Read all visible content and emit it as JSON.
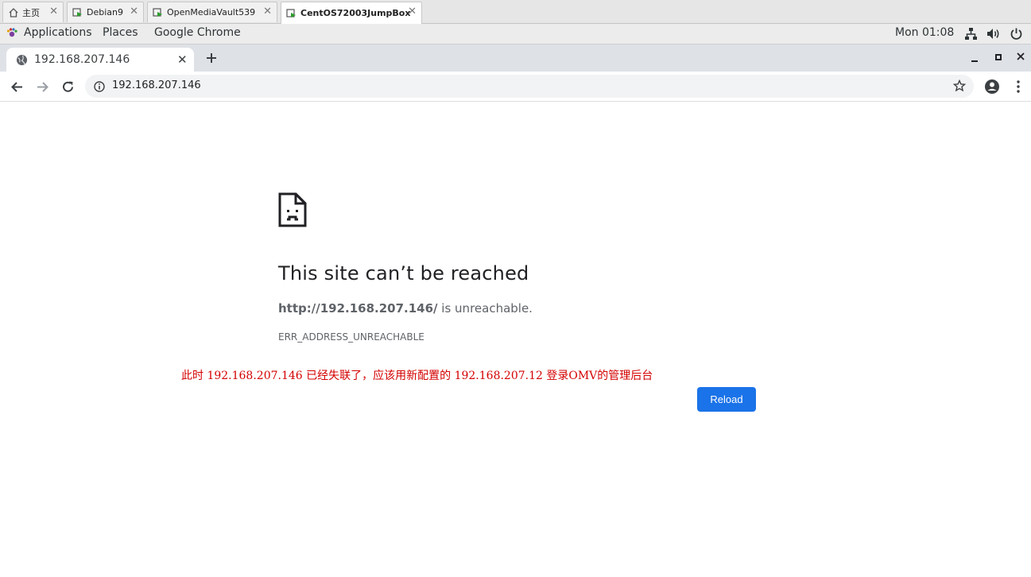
{
  "vm_tabs": [
    {
      "label": "主页"
    },
    {
      "label": "Debian9"
    },
    {
      "label": "OpenMediaVault539"
    },
    {
      "label": "CentOS72003JumpBox"
    }
  ],
  "gnome": {
    "applications": "Applications",
    "places": "Places",
    "app_name": "Google Chrome",
    "clock": "Mon 01:08"
  },
  "chrome": {
    "tab_title": "192.168.207.146",
    "url": "192.168.207.146"
  },
  "error": {
    "title": "This site can’t be reached",
    "host": "http://192.168.207.146/",
    "desc_suffix": " is unreachable.",
    "code": "ERR_ADDRESS_UNREACHABLE",
    "reload_label": "Reload"
  },
  "annotation": "此时 192.168.207.146 已经失联了，应该用新配置的 192.168.207.12 登录OMV的管理后台",
  "colors": {
    "accent": "#1a73e8",
    "annotation": "#d40000"
  }
}
